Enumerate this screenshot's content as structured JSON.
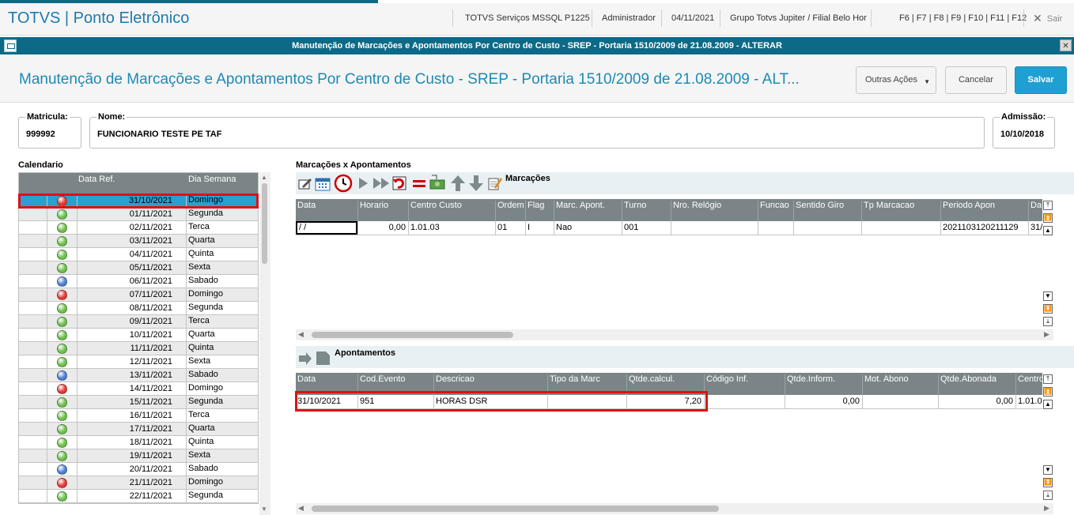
{
  "app": {
    "title": "TOTVS | Ponto Eletrônico",
    "server": "TOTVS Serviços MSSQL P1225",
    "user": "Administrador",
    "date": "04/11/2021",
    "company": "Grupo Totvs Jupiter / Filial Belo Hor",
    "shortcuts": "F6 | F7 | F8 | F9 | F10 | F11 | F12",
    "exit_label": "Sair"
  },
  "window": {
    "title": "Manutenção de Marcações e Apontamentos Por Centro de Custo - SREP - Portaria 1510/2009 de 21.08.2009 - ALTERAR"
  },
  "header": {
    "title": "Manutenção de Marcações e Apontamentos Por Centro de Custo - SREP - Portaria 1510/2009 de 21.08.2009 - ALT...",
    "other_actions": "Outras Ações",
    "cancel": "Cancelar",
    "save": "Salvar"
  },
  "fields": {
    "matricula_label": "Matricula:",
    "matricula_value": "999992",
    "nome_label": "Nome:",
    "nome_value": "FUNCIONARIO TESTE PE TAF",
    "admissao_label": "Admissão:",
    "admissao_value": "10/10/2018"
  },
  "calendar": {
    "label": "Calendario",
    "headers": [
      "",
      "",
      "Data Ref.",
      "Dia Semana"
    ],
    "rows": [
      {
        "status": "red",
        "date": "31/10/2021",
        "day": "Domingo"
      },
      {
        "status": "green",
        "date": "01/11/2021",
        "day": "Segunda"
      },
      {
        "status": "green",
        "date": "02/11/2021",
        "day": "Terca"
      },
      {
        "status": "green",
        "date": "03/11/2021",
        "day": "Quarta"
      },
      {
        "status": "green",
        "date": "04/11/2021",
        "day": "Quinta"
      },
      {
        "status": "green",
        "date": "05/11/2021",
        "day": "Sexta"
      },
      {
        "status": "blue",
        "date": "06/11/2021",
        "day": "Sabado"
      },
      {
        "status": "red",
        "date": "07/11/2021",
        "day": "Domingo"
      },
      {
        "status": "green",
        "date": "08/11/2021",
        "day": "Segunda"
      },
      {
        "status": "green",
        "date": "09/11/2021",
        "day": "Terca"
      },
      {
        "status": "green",
        "date": "10/11/2021",
        "day": "Quarta"
      },
      {
        "status": "green",
        "date": "11/11/2021",
        "day": "Quinta"
      },
      {
        "status": "green",
        "date": "12/11/2021",
        "day": "Sexta"
      },
      {
        "status": "blue",
        "date": "13/11/2021",
        "day": "Sabado"
      },
      {
        "status": "red",
        "date": "14/11/2021",
        "day": "Domingo"
      },
      {
        "status": "green",
        "date": "15/11/2021",
        "day": "Segunda"
      },
      {
        "status": "green",
        "date": "16/11/2021",
        "day": "Terca"
      },
      {
        "status": "green",
        "date": "17/11/2021",
        "day": "Quarta"
      },
      {
        "status": "green",
        "date": "18/11/2021",
        "day": "Quinta"
      },
      {
        "status": "green",
        "date": "19/11/2021",
        "day": "Sexta"
      },
      {
        "status": "blue",
        "date": "20/11/2021",
        "day": "Sabado"
      },
      {
        "status": "red",
        "date": "21/11/2021",
        "day": "Domingo"
      },
      {
        "status": "green",
        "date": "22/11/2021",
        "day": "Segunda"
      }
    ]
  },
  "marcacoes": {
    "section_label": "Marcações x Apontamentos",
    "toolbar_label": "Marcações",
    "headers": [
      "Data",
      "Horario",
      "Centro Custo",
      "Ordem",
      "Flag",
      "Marc. Apont.",
      "Turno",
      "Nro. Relógio",
      "Funcao",
      "Sentido Giro",
      "Tp Marcacao",
      "Periodo Apon",
      "Da"
    ],
    "row": [
      " /  / ",
      "0,00",
      "1.01.03",
      "01",
      "I",
      "Nao",
      "001",
      "",
      "",
      "",
      "",
      "2021103120211129",
      "31/"
    ]
  },
  "apontamentos": {
    "toolbar_label": "Apontamentos",
    "headers": [
      "Data",
      "Cod.Evento",
      "Descricao",
      "Tipo da Marc",
      "Qtde.calcul.",
      "Código Inf.",
      "Qtde.Inform.",
      "Mot. Abono",
      "Qtde.Abonada",
      "Centro"
    ],
    "row": [
      "31/10/2021",
      "951",
      "HORAS DSR",
      "",
      "7,20",
      "",
      "0,00",
      "",
      "0,00",
      "1.01.0"
    ]
  },
  "colors": {
    "brand_blue": "#1c7ab0",
    "title_bar": "#0c6a86",
    "selected_row": "#2b9fd0",
    "primary_button": "#1fa0d3",
    "highlight": "#e01010",
    "status_red": "#e53935",
    "status_green": "#6cc24a",
    "status_blue": "#4a7fd0"
  }
}
